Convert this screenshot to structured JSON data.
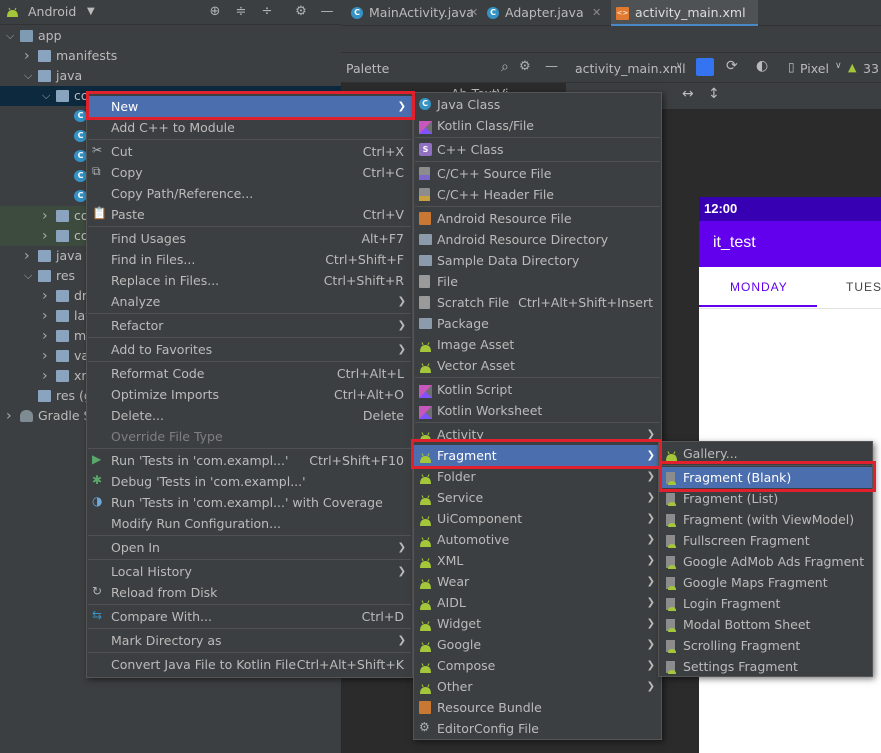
{
  "project_panel": {
    "view_selector": "Android",
    "tree": [
      {
        "label": "app",
        "indent": 0,
        "arrow": "v",
        "icon": "module"
      },
      {
        "label": "manifests",
        "indent": 1,
        "arrow": ">",
        "icon": "folder"
      },
      {
        "label": "java",
        "indent": 1,
        "arrow": "v",
        "icon": "folder"
      },
      {
        "label": "co",
        "indent": 2,
        "arrow": "v",
        "icon": "package"
      },
      {
        "label": "",
        "indent": 3,
        "arrow": "",
        "icon": "class"
      },
      {
        "label": "",
        "indent": 3,
        "arrow": "",
        "icon": "class"
      },
      {
        "label": "",
        "indent": 3,
        "arrow": "",
        "icon": "class"
      },
      {
        "label": "",
        "indent": 3,
        "arrow": "",
        "icon": "class"
      },
      {
        "label": "",
        "indent": 3,
        "arrow": "",
        "icon": "class"
      },
      {
        "label": "co",
        "indent": 2,
        "arrow": ">",
        "icon": "package"
      },
      {
        "label": "co",
        "indent": 2,
        "arrow": ">",
        "icon": "package"
      },
      {
        "label": "java (",
        "indent": 1,
        "arrow": ">",
        "icon": "folder"
      },
      {
        "label": "res",
        "indent": 1,
        "arrow": "v",
        "icon": "res"
      },
      {
        "label": "dr",
        "indent": 2,
        "arrow": ">",
        "icon": "folder"
      },
      {
        "label": "lay",
        "indent": 2,
        "arrow": ">",
        "icon": "folder"
      },
      {
        "label": "m",
        "indent": 2,
        "arrow": ">",
        "icon": "folder"
      },
      {
        "label": "va",
        "indent": 2,
        "arrow": ">",
        "icon": "folder"
      },
      {
        "label": "xn",
        "indent": 2,
        "arrow": ">",
        "icon": "folder"
      },
      {
        "label": "res (g",
        "indent": 1,
        "arrow": "",
        "icon": "folder"
      },
      {
        "label": "Gradle S",
        "indent": 0,
        "arrow": ">",
        "icon": "gradle"
      }
    ]
  },
  "editor_tabs": [
    {
      "label": "MainActivity.java",
      "icon": "C",
      "active": false
    },
    {
      "label": "Adapter.java",
      "icon": "C",
      "active": false
    },
    {
      "label": "activity_main.xml",
      "icon": "xml",
      "active": true
    }
  ],
  "palette": {
    "title": "Palette",
    "search_icon": "search-icon",
    "settings_icon": "gear-icon",
    "first_item": "Ab TextVi"
  },
  "design_toolbar": {
    "file": "activity_main.xml",
    "device": "Pixel",
    "api": "33"
  },
  "phone_preview": {
    "time": "12:00",
    "app_title": "it_test",
    "tabs": [
      "MONDAY",
      "TUES"
    ],
    "colors": {
      "status_bar": "#3700b3",
      "app_bar": "#6200ee",
      "indicator": "#6200ee"
    }
  },
  "context_menu": {
    "items": [
      {
        "label": "New",
        "shortcut": "",
        "submenu": true,
        "icon": "",
        "selected": true
      },
      {
        "label": "Add C++ to Module",
        "shortcut": "",
        "submenu": false,
        "icon": ""
      },
      {
        "sep": true
      },
      {
        "label": "Cut",
        "shortcut": "Ctrl+X",
        "icon": "scissors-icon"
      },
      {
        "label": "Copy",
        "shortcut": "Ctrl+C",
        "icon": "copy-icon"
      },
      {
        "label": "Copy Path/Reference...",
        "shortcut": "",
        "icon": ""
      },
      {
        "label": "Paste",
        "shortcut": "Ctrl+V",
        "icon": "paste-icon"
      },
      {
        "sep": true
      },
      {
        "label": "Find Usages",
        "shortcut": "Alt+F7",
        "icon": ""
      },
      {
        "label": "Find in Files...",
        "shortcut": "Ctrl+Shift+F",
        "icon": ""
      },
      {
        "label": "Replace in Files...",
        "shortcut": "Ctrl+Shift+R",
        "icon": ""
      },
      {
        "label": "Analyze",
        "shortcut": "",
        "submenu": true,
        "icon": ""
      },
      {
        "sep": true
      },
      {
        "label": "Refactor",
        "shortcut": "",
        "submenu": true,
        "icon": ""
      },
      {
        "sep": true
      },
      {
        "label": "Add to Favorites",
        "shortcut": "",
        "submenu": true,
        "icon": ""
      },
      {
        "sep": true
      },
      {
        "label": "Reformat Code",
        "shortcut": "Ctrl+Alt+L",
        "icon": ""
      },
      {
        "label": "Optimize Imports",
        "shortcut": "Ctrl+Alt+O",
        "icon": ""
      },
      {
        "label": "Delete...",
        "shortcut": "Delete",
        "icon": ""
      },
      {
        "label": "Override File Type",
        "shortcut": "",
        "icon": "",
        "disabled": true
      },
      {
        "sep": true
      },
      {
        "label": "Run 'Tests in 'com.exampl...'",
        "shortcut": "Ctrl+Shift+F10",
        "icon": "run-icon"
      },
      {
        "label": "Debug 'Tests in 'com.exampl...'",
        "shortcut": "",
        "icon": "debug-icon"
      },
      {
        "label": "Run 'Tests in 'com.exampl...' with Coverage",
        "shortcut": "",
        "icon": "coverage-icon"
      },
      {
        "label": "Modify Run Configuration...",
        "shortcut": "",
        "icon": ""
      },
      {
        "sep": true
      },
      {
        "label": "Open In",
        "shortcut": "",
        "submenu": true,
        "icon": ""
      },
      {
        "sep": true
      },
      {
        "label": "Local History",
        "shortcut": "",
        "submenu": true,
        "icon": ""
      },
      {
        "label": "Reload from Disk",
        "shortcut": "",
        "icon": "reload-icon"
      },
      {
        "sep": true
      },
      {
        "label": "Compare With...",
        "shortcut": "Ctrl+D",
        "icon": "compare-icon"
      },
      {
        "sep": true
      },
      {
        "label": "Mark Directory as",
        "shortcut": "",
        "submenu": true,
        "icon": ""
      },
      {
        "sep": true
      },
      {
        "label": "Convert Java File to Kotlin File",
        "shortcut": "Ctrl+Alt+Shift+K",
        "icon": ""
      }
    ]
  },
  "new_submenu": {
    "items": [
      {
        "label": "Java Class",
        "icon": "java-class-icon"
      },
      {
        "label": "Kotlin Class/File",
        "icon": "kotlin-icon"
      },
      {
        "sep": true
      },
      {
        "label": "C++ Class",
        "icon": "cpp-class-icon"
      },
      {
        "sep": true
      },
      {
        "label": "C/C++ Source File",
        "icon": "cpp-source-icon"
      },
      {
        "label": "C/C++ Header File",
        "icon": "cpp-header-icon"
      },
      {
        "sep": true
      },
      {
        "label": "Android Resource File",
        "icon": "resource-file-icon"
      },
      {
        "label": "Android Resource Directory",
        "icon": "folder-icon"
      },
      {
        "label": "Sample Data Directory",
        "icon": "folder-icon"
      },
      {
        "label": "File",
        "icon": "file-icon"
      },
      {
        "label": "Scratch File",
        "shortcut": "Ctrl+Alt+Shift+Insert",
        "icon": "scratch-icon"
      },
      {
        "label": "Package",
        "icon": "package-icon"
      },
      {
        "label": "Image Asset",
        "icon": "android-icon"
      },
      {
        "label": "Vector Asset",
        "icon": "android-icon"
      },
      {
        "sep": true
      },
      {
        "label": "Kotlin Script",
        "icon": "kotlin-script-icon"
      },
      {
        "label": "Kotlin Worksheet",
        "icon": "kotlin-script-icon"
      },
      {
        "sep": true
      },
      {
        "label": "Activity",
        "submenu": true,
        "icon": "android-icon"
      },
      {
        "label": "Fragment",
        "submenu": true,
        "icon": "android-icon",
        "selected": true
      },
      {
        "label": "Folder",
        "submenu": true,
        "icon": "android-icon"
      },
      {
        "label": "Service",
        "submenu": true,
        "icon": "android-icon"
      },
      {
        "label": "UiComponent",
        "submenu": true,
        "icon": "android-icon"
      },
      {
        "label": "Automotive",
        "submenu": true,
        "icon": "android-icon"
      },
      {
        "label": "XML",
        "submenu": true,
        "icon": "android-icon"
      },
      {
        "label": "Wear",
        "submenu": true,
        "icon": "android-icon"
      },
      {
        "label": "AIDL",
        "submenu": true,
        "icon": "android-icon"
      },
      {
        "label": "Widget",
        "submenu": true,
        "icon": "android-icon"
      },
      {
        "label": "Google",
        "submenu": true,
        "icon": "android-icon"
      },
      {
        "label": "Compose",
        "submenu": true,
        "icon": "android-icon"
      },
      {
        "label": "Other",
        "submenu": true,
        "icon": "android-icon"
      },
      {
        "label": "Resource Bundle",
        "icon": "resource-bundle-icon"
      },
      {
        "label": "EditorConfig File",
        "icon": "gear-icon"
      }
    ]
  },
  "fragment_submenu": {
    "items": [
      {
        "label": "Gallery...",
        "icon": "android-icon"
      },
      {
        "sep": true
      },
      {
        "label": "Fragment (Blank)",
        "icon": "template-icon",
        "selected": true
      },
      {
        "label": "Fragment (List)",
        "icon": "template-icon"
      },
      {
        "label": "Fragment (with ViewModel)",
        "icon": "template-icon"
      },
      {
        "label": "Fullscreen Fragment",
        "icon": "template-icon"
      },
      {
        "label": "Google AdMob Ads Fragment",
        "icon": "template-icon"
      },
      {
        "label": "Google Maps Fragment",
        "icon": "template-icon"
      },
      {
        "label": "Login Fragment",
        "icon": "template-icon"
      },
      {
        "label": "Modal Bottom Sheet",
        "icon": "template-icon"
      },
      {
        "label": "Scrolling Fragment",
        "icon": "template-icon"
      },
      {
        "label": "Settings Fragment",
        "icon": "template-icon"
      }
    ]
  }
}
